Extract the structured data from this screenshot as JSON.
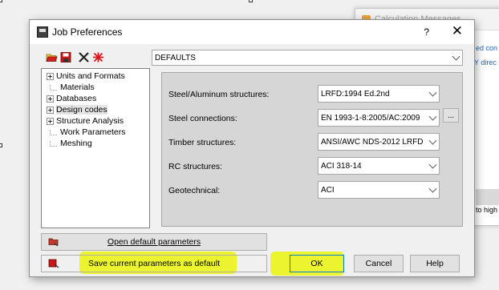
{
  "background_window": {
    "title": "Calculation Messages",
    "fragment_1": "ed con",
    "fragment_2": "Y direc",
    "fragment_3": "to high"
  },
  "dialog": {
    "title": "Job Preferences",
    "help_glyph": "?",
    "close_glyph": "✕"
  },
  "toolbar": {
    "profile_value": "DEFAULTS"
  },
  "tree": {
    "items": [
      {
        "label": "Units and Formats",
        "expandable": true
      },
      {
        "label": "Materials",
        "expandable": false
      },
      {
        "label": "Databases",
        "expandable": true
      },
      {
        "label": "Design codes",
        "expandable": true
      },
      {
        "label": "Structure Analysis",
        "expandable": true
      },
      {
        "label": "Work Parameters",
        "expandable": false
      },
      {
        "label": "Meshing",
        "expandable": false
      }
    ]
  },
  "design_codes": {
    "steel_aluminum": {
      "label": "Steel/Aluminum structures:",
      "value": "LRFD:1994 Ed.2nd"
    },
    "steel_connections": {
      "label": "Steel connections:",
      "value": "EN 1993-1-8:2005/AC:2009",
      "more": "..."
    },
    "timber": {
      "label": "Timber structures:",
      "value": "ANSI/AWC NDS-2012 LRFD"
    },
    "rc": {
      "label": "RC structures:",
      "value": "ACI 318-14"
    },
    "geotechnical": {
      "label": "Geotechnical:",
      "value": "ACI"
    }
  },
  "buttons": {
    "open_default": "Open default parameters",
    "save_default": "Save current parameters as default",
    "ok": "OK",
    "cancel": "Cancel",
    "help": "Help"
  },
  "colors": {
    "highlight": "#ebf500",
    "ok_border": "#0078d7"
  }
}
